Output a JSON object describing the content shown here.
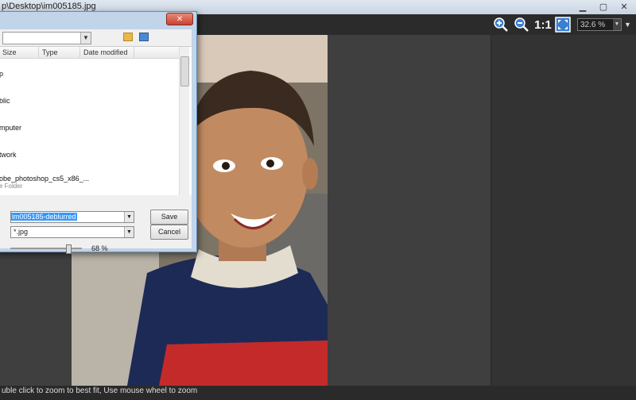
{
  "titlebar": {
    "title": "p\\Desktop\\im005185.jpg"
  },
  "toolbar": {
    "zoom_in_icon": "zoom-in-icon",
    "zoom_out_icon": "zoom-out-icon",
    "actual_size_label": "1:1",
    "fit_icon": "fit-to-window-icon",
    "zoom_value": "32.6 %"
  },
  "dialog": {
    "columns": [
      "Size",
      "Type",
      "Date modified"
    ],
    "items": [
      {
        "name": "p",
        "sub": ""
      },
      {
        "name": "blic",
        "sub": ""
      },
      {
        "name": "mputer",
        "sub": ""
      },
      {
        "name": "twork",
        "sub": ""
      },
      {
        "name": "obe_photoshop_cs5_x86_...",
        "sub": "e Folder"
      }
    ],
    "filename": "im005185-deblurred",
    "filetype": "*.jpg",
    "save_label": "Save",
    "cancel_label": "Cancel",
    "quality": "68 %"
  },
  "status": {
    "text": "uble click to zoom to best fit, Use mouse wheel to zoom"
  },
  "colors": {
    "viewer_bg": "#3f3f3f",
    "dialog_frame": "#c0d4ea",
    "selection": "#3399ff"
  }
}
